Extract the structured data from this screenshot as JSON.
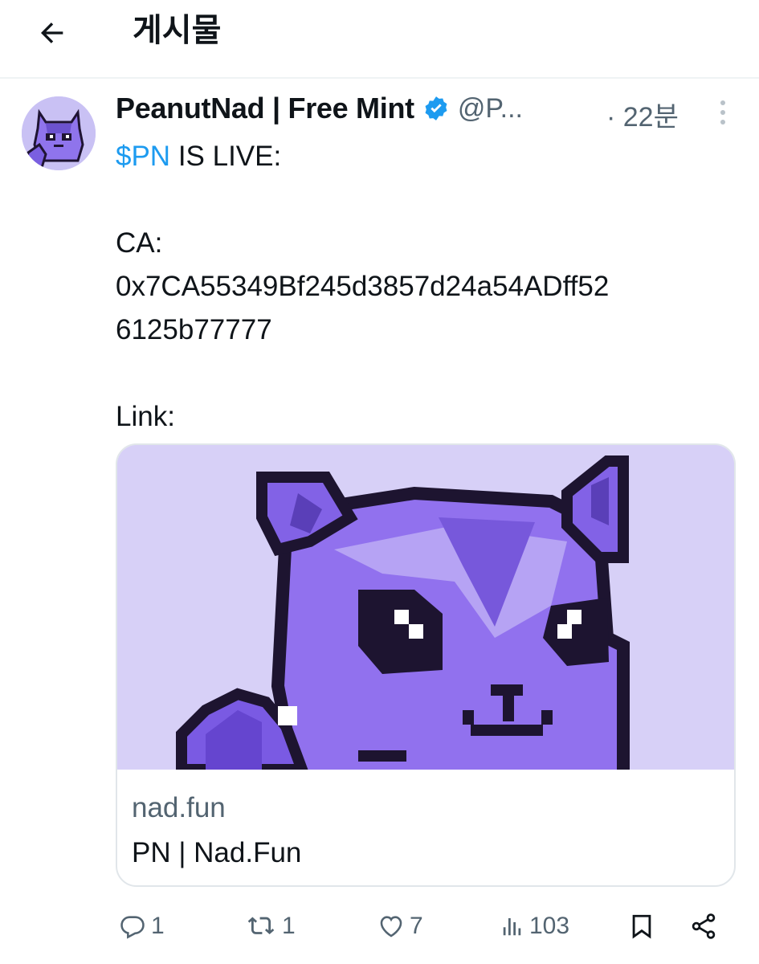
{
  "header": {
    "title": "게시물"
  },
  "post": {
    "display_name": "PeanutNad | Free Mint",
    "handle": "@P...",
    "time": "· 22분",
    "cashtag": "$PN",
    "text_rest": " IS LIVE:\n\nCA:\n0x7CA55349Bf245d3857d24a54ADff52\n6125b77777\n\nLink:"
  },
  "card": {
    "domain": "nad.fun",
    "title": "PN | Nad.Fun"
  },
  "actions": {
    "replies": "1",
    "reposts": "1",
    "likes": "7",
    "views": "103"
  },
  "colors": {
    "accent": "#1d9bf0",
    "muted": "#536471",
    "card_bg": "#d7d0f7"
  },
  "icons": [
    "back-arrow-icon",
    "verified-badge-icon",
    "more-vertical-icon",
    "reply-icon",
    "repost-icon",
    "like-icon",
    "views-icon",
    "bookmark-icon",
    "share-icon"
  ]
}
